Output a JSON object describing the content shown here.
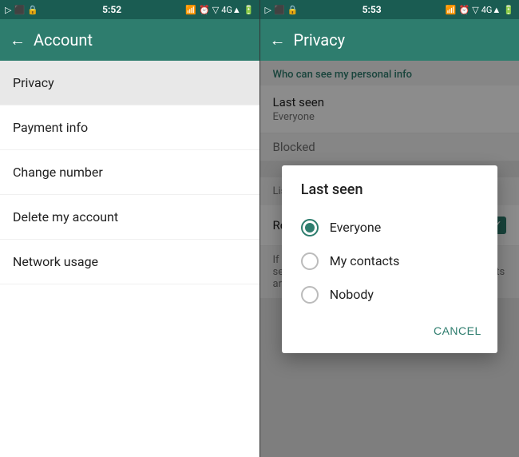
{
  "left": {
    "statusBar": {
      "left": "▷ ⬛ 🔒",
      "time": "5:52",
      "icons": "📶 ⊙ ▽ 4G▲ 📶"
    },
    "toolbar": {
      "backIcon": "←",
      "title": "Account"
    },
    "menuItems": [
      {
        "id": "privacy",
        "label": "Privacy",
        "active": true
      },
      {
        "id": "payment-info",
        "label": "Payment info",
        "active": false
      },
      {
        "id": "change-number",
        "label": "Change number",
        "active": false
      },
      {
        "id": "delete-account",
        "label": "Delete my account",
        "active": false
      },
      {
        "id": "network-usage",
        "label": "Network usage",
        "active": false
      }
    ]
  },
  "right": {
    "statusBar": {
      "left": "▷ ⬛ 🔒",
      "time": "5:53",
      "icons": "📶 ⊙ ▽ 4G▲ 📶"
    },
    "toolbar": {
      "backIcon": "←",
      "title": "Privacy"
    },
    "sectionHeader": "Who can see my personal info",
    "lastSeen": {
      "label": "Last seen",
      "value": "Everyone"
    },
    "blockedDesc": "List of contacts that you have blocked.",
    "readReceipts": {
      "label": "Read receipts",
      "checked": true
    },
    "readReceiptsDesc": "If you turn off read receipts, you won't be able to see read receipts from other people. Read receipts are always sent for group chats.",
    "dialog": {
      "title": "Last seen",
      "options": [
        {
          "id": "everyone",
          "label": "Everyone",
          "selected": true
        },
        {
          "id": "my-contacts",
          "label": "My contacts",
          "selected": false
        },
        {
          "id": "nobody",
          "label": "Nobody",
          "selected": false
        }
      ],
      "cancelLabel": "CANCEL"
    }
  },
  "colors": {
    "brand": "#2e7d6e",
    "brandDark": "#1a5c52"
  }
}
